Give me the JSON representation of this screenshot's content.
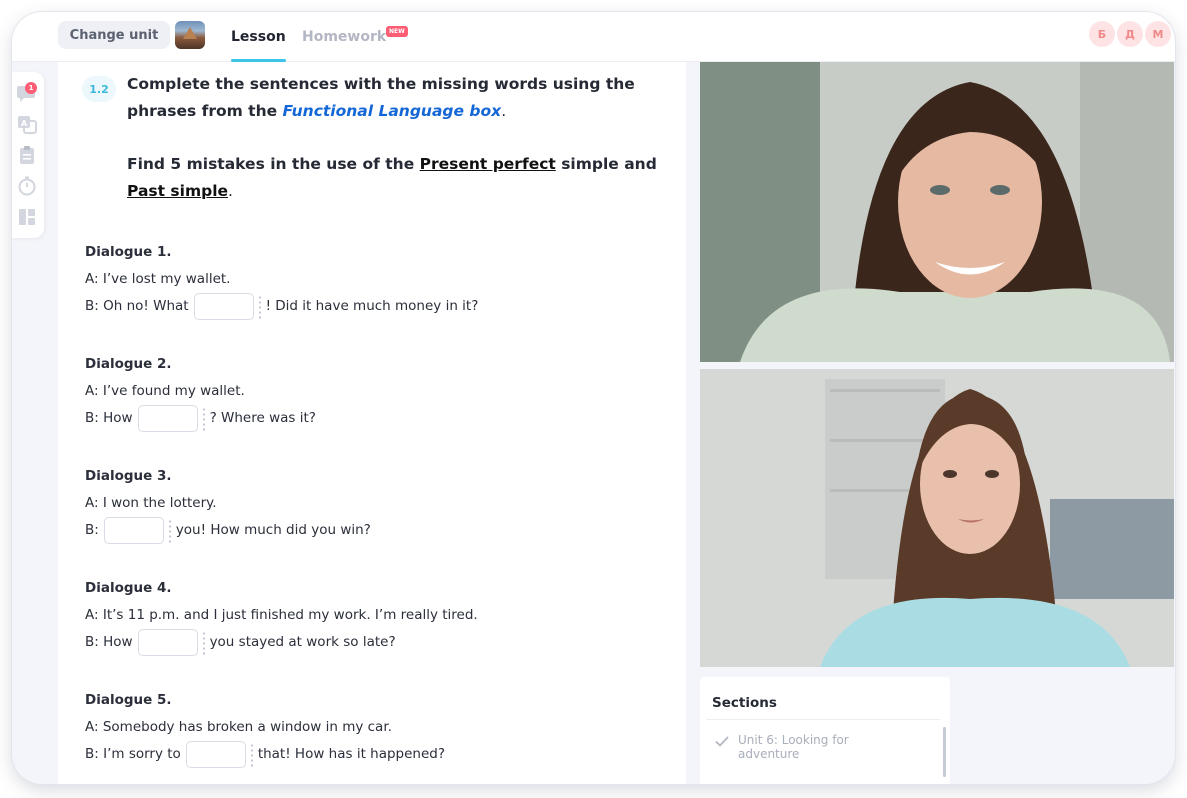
{
  "header": {
    "change_unit_label": "Change unit",
    "tabs": [
      {
        "label": "Lesson",
        "active": true
      },
      {
        "label": "Homework",
        "badge": "NEW"
      }
    ],
    "avatars": [
      "Б",
      "Д",
      "М"
    ]
  },
  "rail": {
    "icons": [
      "chat-icon",
      "translate-icon",
      "clipboard-icon",
      "timer-icon",
      "layout-icon"
    ],
    "chat_badge": "1"
  },
  "exercise": {
    "number": "1.2",
    "instruction_1": {
      "before": "Complete the sentences with the missing words using the phrases from the ",
      "link": "Functional Language box",
      "after": "."
    },
    "instruction_2": {
      "before": "Find 5 mistakes in the use of the ",
      "term_1": "Present perfect",
      "middle": " simple and ",
      "term_2": "Past simple",
      "after": "."
    },
    "dialogues": [
      {
        "title": "Dialogue 1.",
        "a": "A: I’ve lost my wallet.",
        "b_before": "B: Oh no! What",
        "b_after": "! Did it have much money in it?"
      },
      {
        "title": "Dialogue 2.",
        "a": "A: I’ve found my wallet.",
        "b_before": "B: How",
        "b_after": "? Where was it?"
      },
      {
        "title": "Dialogue 3.",
        "a": "A: I won the lottery.",
        "b_before": "B:",
        "b_after": "you! How much did you win?"
      },
      {
        "title": "Dialogue 4.",
        "a": "A: It’s 11 p.m. and I just finished my work. I’m really tired.",
        "b_before": "B: How",
        "b_after": "you stayed at work so late?"
      },
      {
        "title": "Dialogue 5.",
        "a": "A: Somebody has broken a window in my car.",
        "b_before": "B: I’m sorry to",
        "b_after": "that! How has it happened?"
      }
    ]
  },
  "sections": {
    "title": "Sections",
    "items": [
      {
        "label": "Unit 6: Looking for adventure"
      }
    ]
  },
  "colors": {
    "accent": "#3cc4e6",
    "link": "#1467d6",
    "badge": "#ff5d73",
    "avatar_bg": "#fde3e3",
    "avatar_text": "#f08a8a"
  }
}
